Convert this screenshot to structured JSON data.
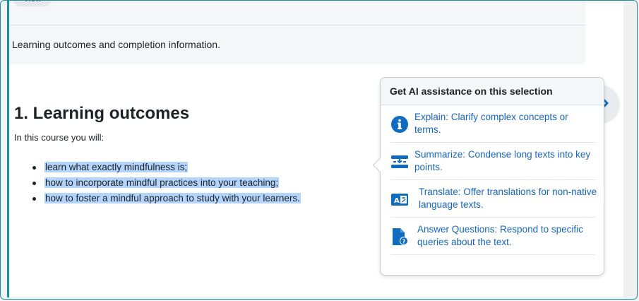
{
  "info": {
    "view_label": "View",
    "description": "Learning outcomes and completion information."
  },
  "section": {
    "title": "1. Learning outcomes",
    "intro": "In this course you will:",
    "outcomes": [
      "learn what exactly mindfulness is;",
      "how to incorporate mindful practices into your teaching;",
      "how to foster a mindful approach to study with your learners."
    ]
  },
  "ai_popover": {
    "title": "Get AI assistance on this selection",
    "items": [
      {
        "icon": "info-icon",
        "label": "Explain: Clarify complex concepts or terms."
      },
      {
        "icon": "summarize-icon",
        "label": "Summarize: Condense long texts into key points."
      },
      {
        "icon": "translate-icon",
        "label": "Translate: Offer translations for non-native language texts."
      },
      {
        "icon": "question-document-icon",
        "label": "Answer Questions: Respond to specific queries about the text."
      }
    ]
  },
  "colors": {
    "accent": "#1a8fa0",
    "link": "#1565c0",
    "selection": "#b3d4fc",
    "icon_blue": "#0f6cbf"
  }
}
